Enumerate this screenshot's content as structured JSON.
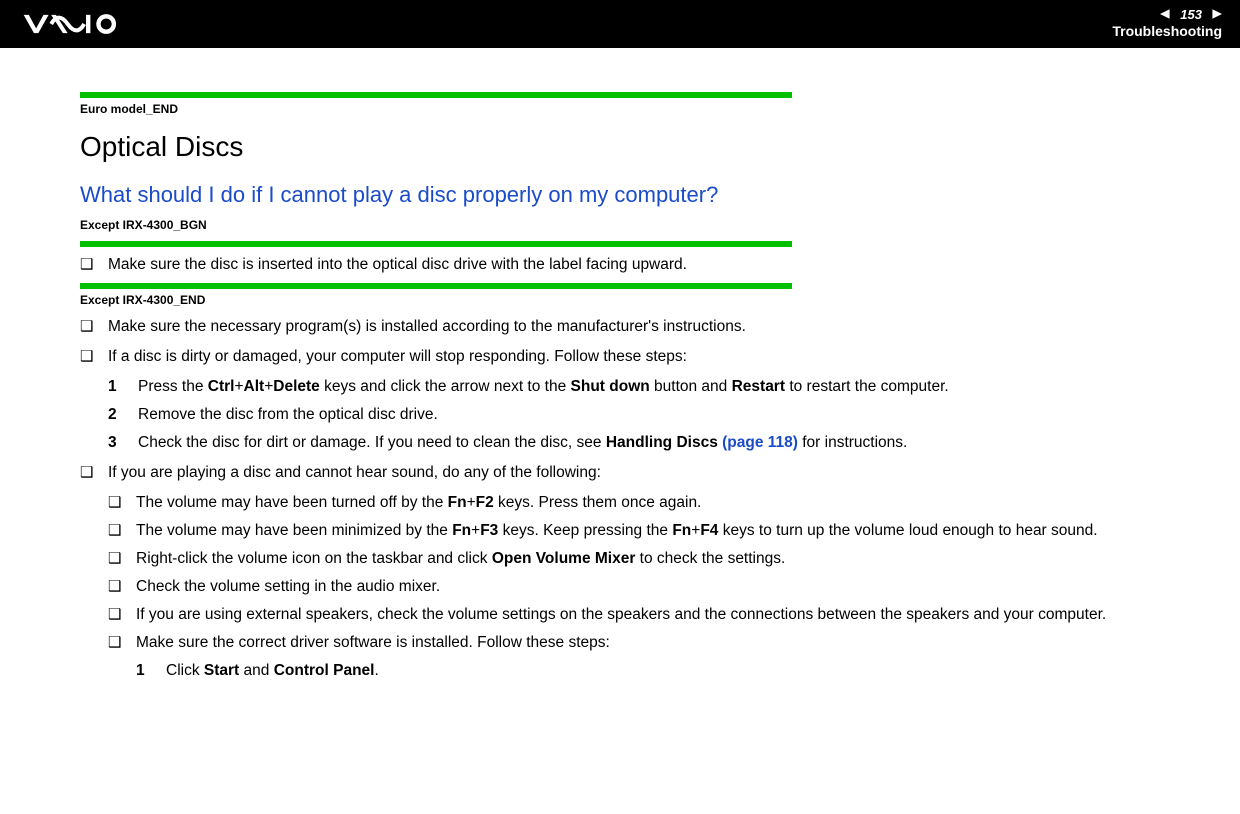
{
  "header": {
    "page_number": "153",
    "section": "Troubleshooting"
  },
  "tags": {
    "euro_end": "Euro model_END",
    "except_bgn": "Except IRX-4300_BGN",
    "except_end": "Except IRX-4300_END"
  },
  "headings": {
    "h1": "Optical Discs",
    "h2": "What should I do if I cannot play a disc properly on my computer?"
  },
  "bullets": {
    "b1": "Make sure the disc is inserted into the optical disc drive with the label facing upward.",
    "b2": "Make sure the necessary program(s) is installed according to the manufacturer's instructions.",
    "b3": "If a disc is dirty or damaged, your computer will stop responding. Follow these steps:",
    "b4": "If you are playing a disc and cannot hear sound, do any of the following:"
  },
  "steps_a": {
    "s1_pre": "Press the ",
    "s1_k1": "Ctrl",
    "s1_plus": "+",
    "s1_k2": "Alt",
    "s1_k3": "Delete",
    "s1_mid": " keys and click the arrow next to the ",
    "s1_k4": "Shut down",
    "s1_mid2": " button and ",
    "s1_k5": "Restart",
    "s1_end": " to restart the computer.",
    "s2": "Remove the disc from the optical disc drive.",
    "s3_pre": "Check the disc for dirt or damage. If you need to clean the disc, see ",
    "s3_b": "Handling Discs ",
    "s3_link": "(page 118)",
    "s3_end": " for instructions."
  },
  "sub_b": {
    "i1_pre": "The volume may have been turned off by the ",
    "i1_k1": "Fn",
    "i1_plus": "+",
    "i1_k2": "F2",
    "i1_end": " keys. Press them once again.",
    "i2_pre": "The volume may have been minimized by the ",
    "i2_k1": "Fn",
    "i2_k2": "F3",
    "i2_mid": " keys. Keep pressing the ",
    "i2_k3": "Fn",
    "i2_k4": "F4",
    "i2_end": " keys to turn up the volume loud enough to hear sound.",
    "i3_pre": "Right-click the volume icon on the taskbar and click ",
    "i3_b": "Open Volume Mixer",
    "i3_end": " to check the settings.",
    "i4": "Check the volume setting in the audio mixer.",
    "i5": "If you are using external speakers, check the volume settings on the speakers and the connections between the speakers and your computer.",
    "i6": "Make sure the correct driver software is installed. Follow these steps:"
  },
  "steps_b": {
    "s1_pre": "Click ",
    "s1_b1": "Start",
    "s1_mid": " and ",
    "s1_b2": "Control Panel",
    "s1_end": "."
  },
  "nums": {
    "n1": "1",
    "n2": "2",
    "n3": "3"
  }
}
